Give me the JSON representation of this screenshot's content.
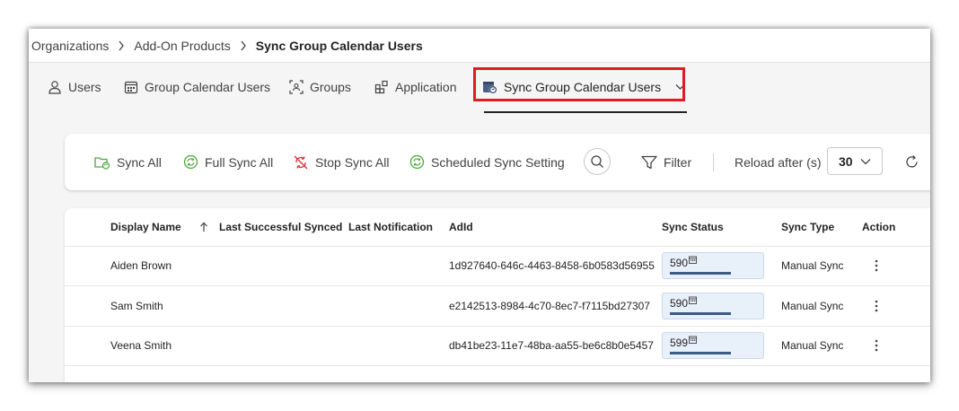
{
  "breadcrumb": {
    "items": [
      "Organizations",
      "Add-On Products",
      "Sync Group Calendar Users"
    ]
  },
  "tabs": [
    {
      "label": "Users",
      "icon": "user-icon"
    },
    {
      "label": "Group Calendar Users",
      "icon": "calendar-icon"
    },
    {
      "label": "Groups",
      "icon": "group-icon"
    },
    {
      "label": "Application",
      "icon": "app-grid-icon"
    },
    {
      "label": "Sync Group Calendar Users",
      "icon": "calendar-sync-icon",
      "active": true
    }
  ],
  "toolbar": {
    "sync_all": "Sync All",
    "full_sync_all": "Full Sync All",
    "stop_sync_all": "Stop Sync All",
    "scheduled_sync_setting": "Scheduled Sync Setting",
    "filter": "Filter",
    "reload_label": "Reload after (s)",
    "reload_value": "30"
  },
  "table": {
    "columns": {
      "display_name": "Display Name",
      "last_successful_synced": "Last Successful Synced",
      "last_notification": "Last Notification",
      "adid": "AdId",
      "sync_status": "Sync Status",
      "sync_type": "Sync Type",
      "action": "Action"
    },
    "rows": [
      {
        "display_name": "Aiden Brown",
        "last_successful_synced": "",
        "last_notification": "",
        "adid": "1d927640-646c-4463-8458-6b0583d56955",
        "sync_status": "590",
        "progress": 1.0,
        "sync_type": "Manual Sync"
      },
      {
        "display_name": "Sam Smith",
        "last_successful_synced": "",
        "last_notification": "",
        "adid": "e2142513-8984-4c70-8ec7-f7115bd27307",
        "sync_status": "590",
        "progress": 1.0,
        "sync_type": "Manual Sync"
      },
      {
        "display_name": "Veena Smith",
        "last_successful_synced": "",
        "last_notification": "",
        "adid": "db41be23-11e7-48ba-aa55-be6c8b0e5457",
        "sync_status": "599",
        "progress": 1.0,
        "sync_type": "Manual Sync"
      }
    ]
  },
  "colors": {
    "highlight": "#e01b24",
    "sync_green": "#4ca83d",
    "stop_red": "#d13438",
    "status_fill": "#3e5a86"
  }
}
